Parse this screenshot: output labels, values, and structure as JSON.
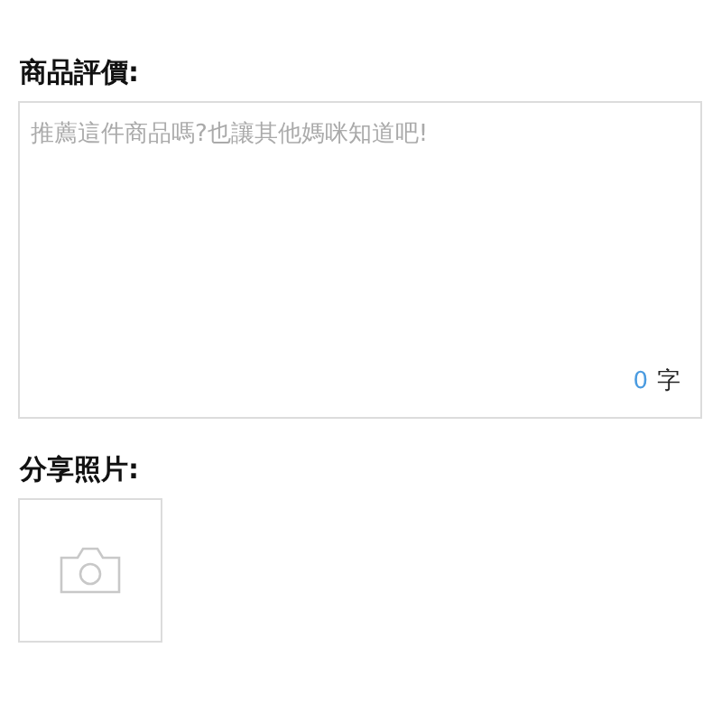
{
  "review": {
    "label": "商品評價:",
    "placeholder": "推薦這件商品嗎?也讓其他媽咪知道吧!",
    "count": "0",
    "count_unit": "字"
  },
  "photos": {
    "label": "分享照片:"
  }
}
